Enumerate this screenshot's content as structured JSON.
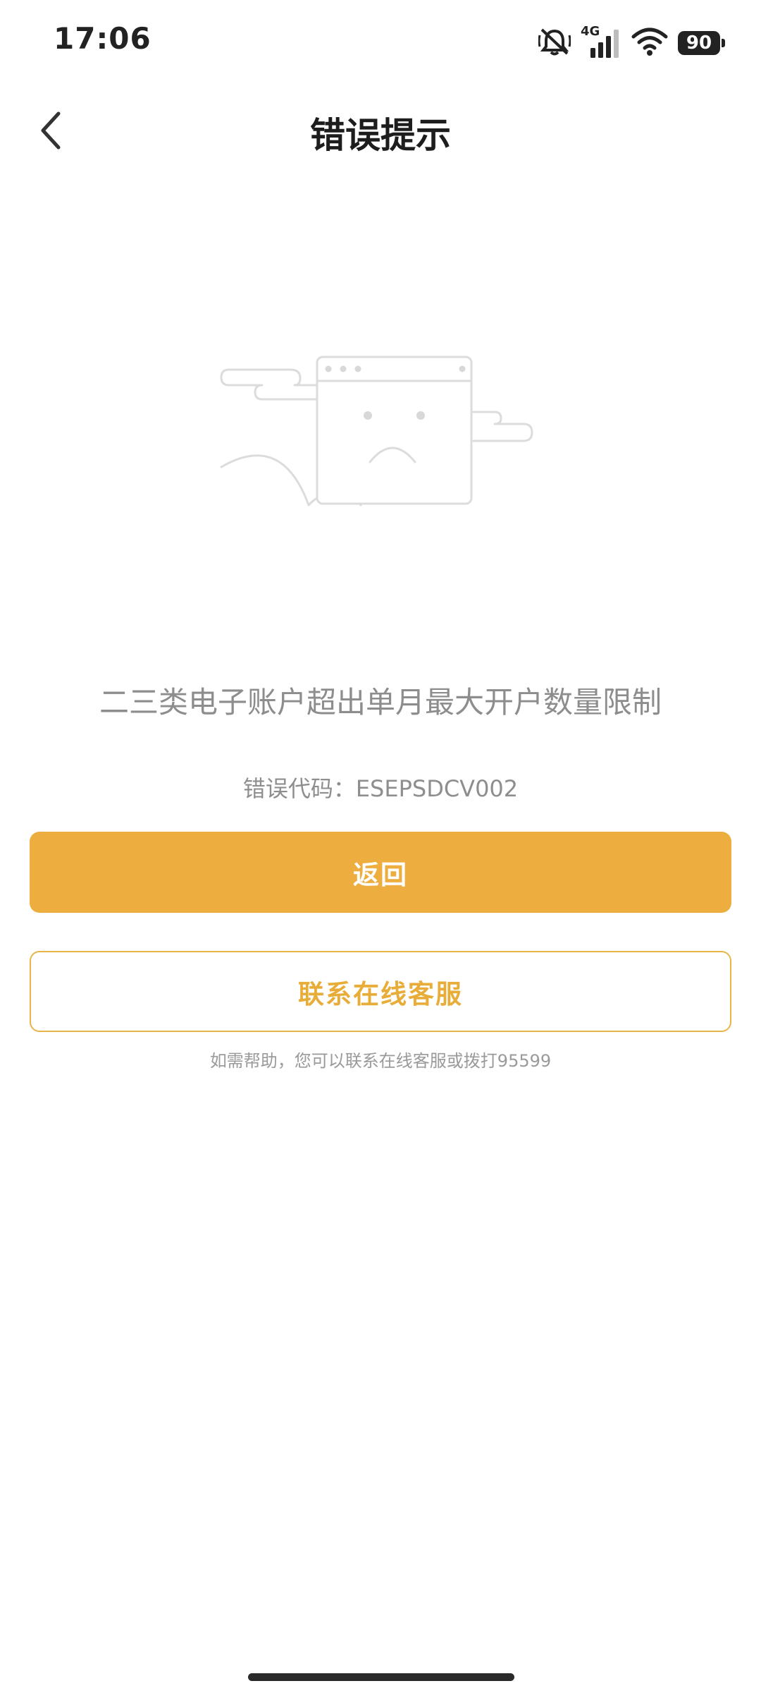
{
  "status_bar": {
    "time": "17:06",
    "network": "4G",
    "battery": "90",
    "icons": [
      "mute-icon",
      "signal-icon",
      "wifi-icon",
      "battery-icon"
    ]
  },
  "header": {
    "title": "错误提示",
    "back_icon": "chevron-left-icon"
  },
  "error": {
    "message": "二三类电子账户超出单月最大开户数量限制",
    "code_text": "错误代码：ESEPSDCV002"
  },
  "actions": {
    "primary_label": "返回",
    "secondary_label": "联系在线客服"
  },
  "help": {
    "text": "如需帮助，您可以联系在线客服或拨打95599"
  },
  "colors": {
    "accent": "#eeae3f",
    "accent_text": "#e8ac38",
    "muted_text": "#8d8d8d"
  }
}
